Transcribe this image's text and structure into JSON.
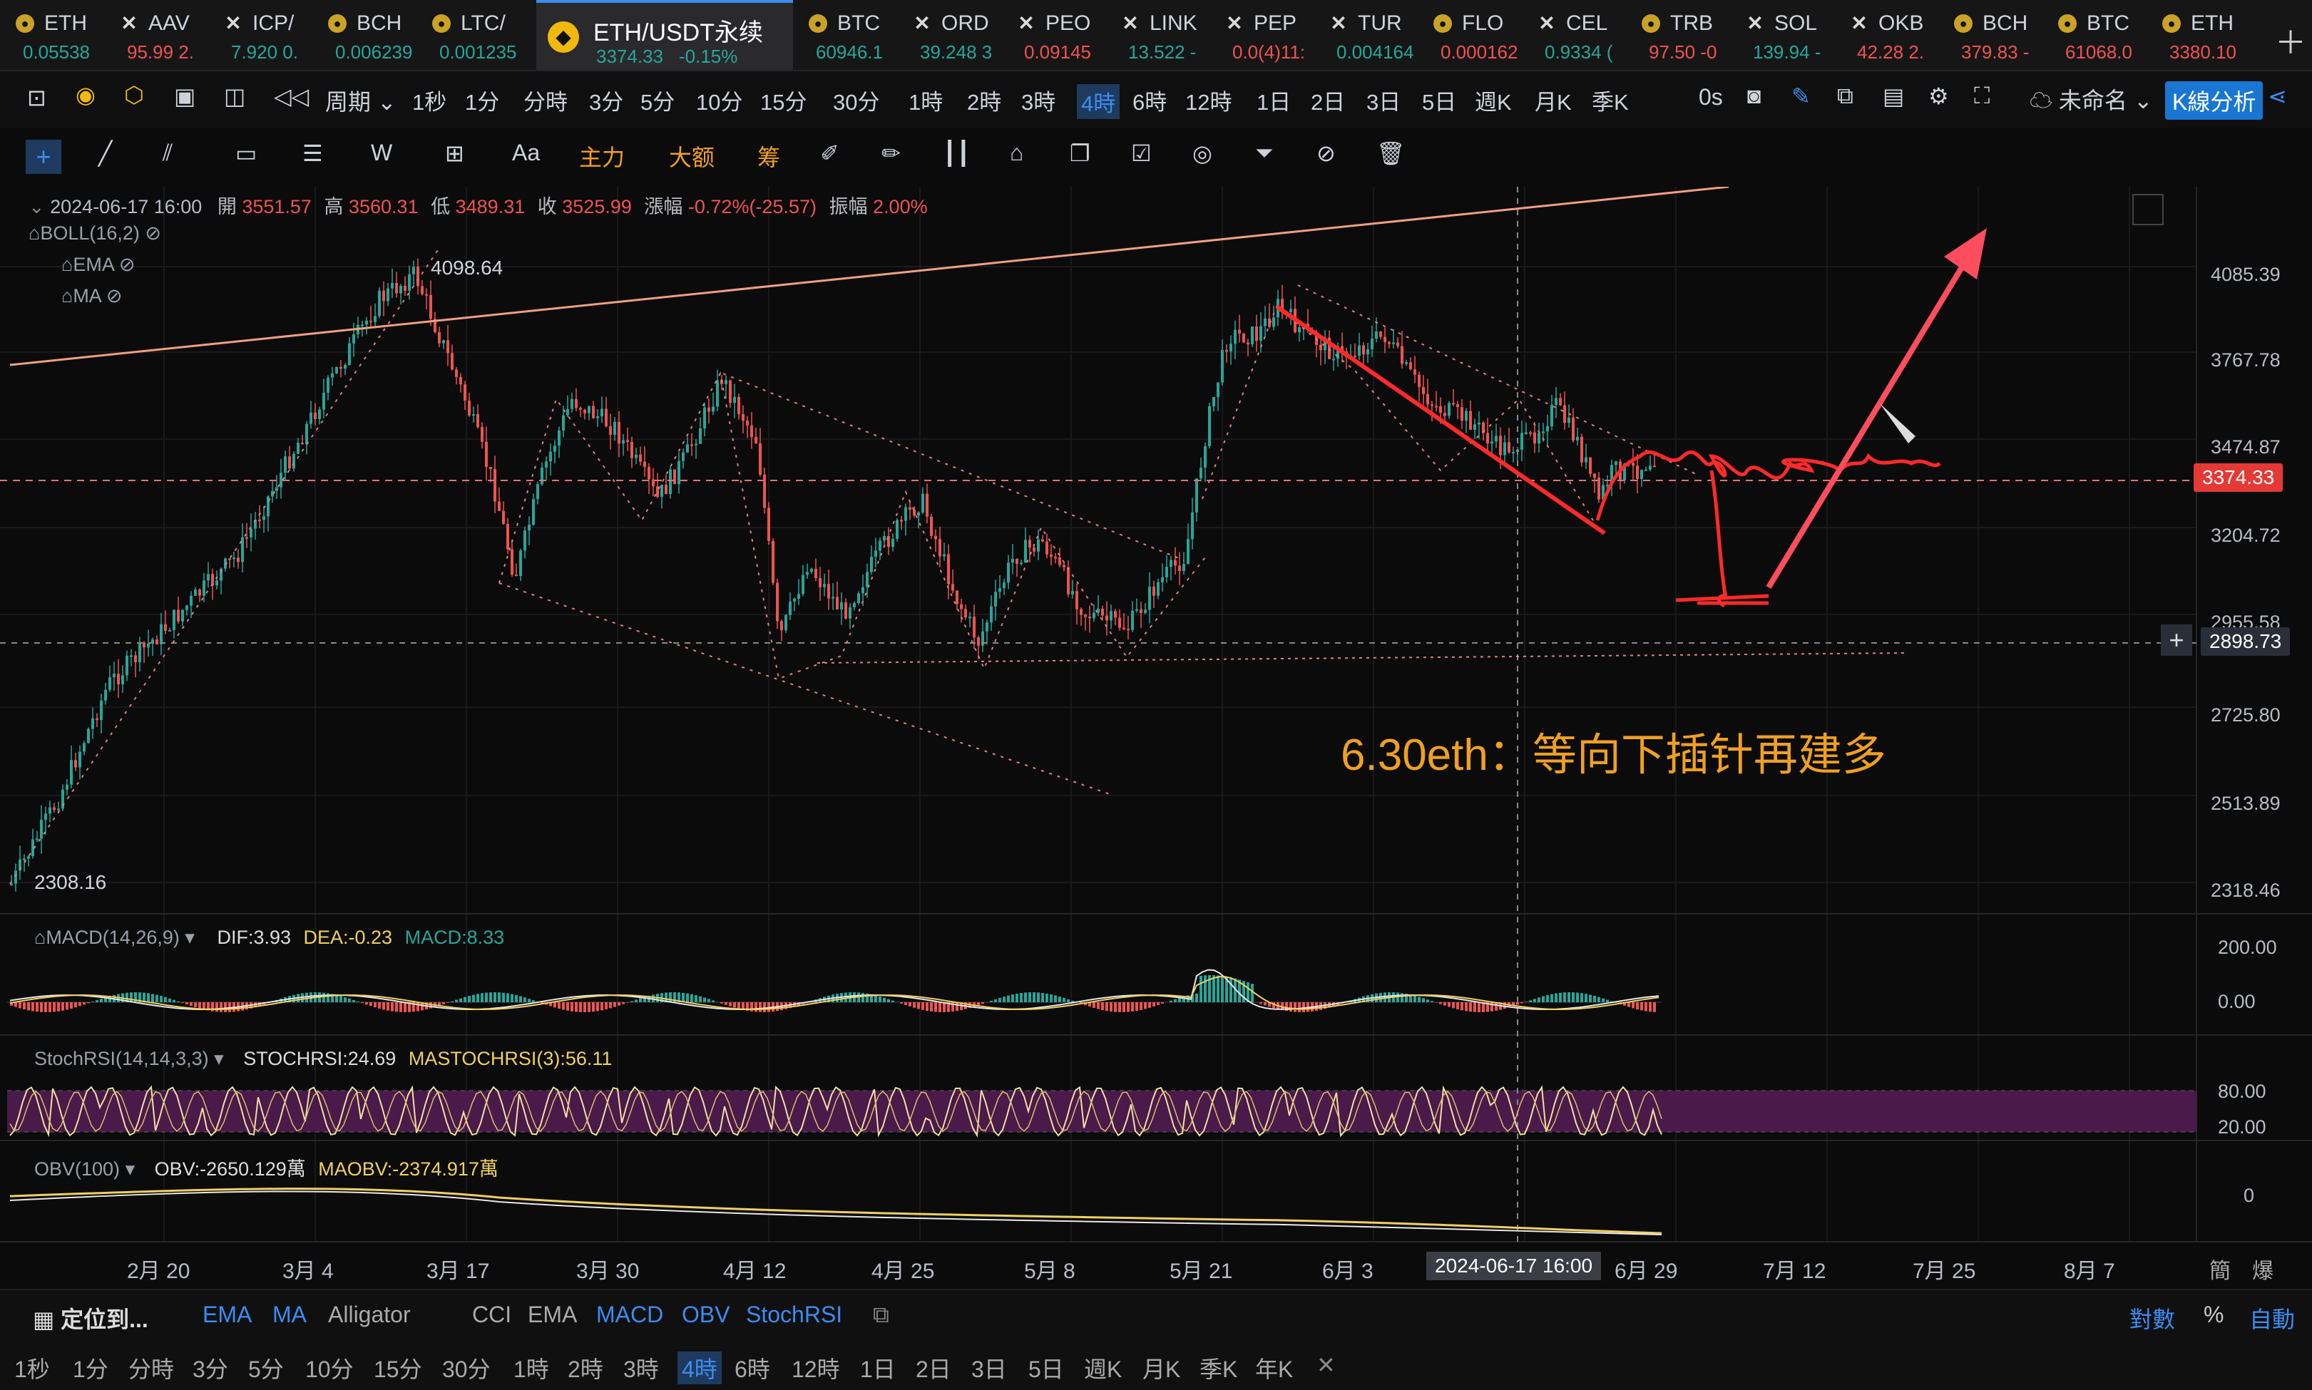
{
  "tickers": [
    {
      "sym": "ETH",
      "val": "0.05538",
      "dir": "up",
      "icon": "coin"
    },
    {
      "sym": "AAV",
      "val": "95.99  2.",
      "dir": "dn",
      "icon": "x"
    },
    {
      "sym": "ICP/",
      "val": "7.920  0.",
      "dir": "up",
      "icon": "x"
    },
    {
      "sym": "BCH",
      "val": "0.006239",
      "dir": "up",
      "icon": "coin"
    },
    {
      "sym": "LTC/",
      "val": "0.001235",
      "dir": "up",
      "icon": "coin"
    },
    {
      "sym": "BTC",
      "val": "60946.1",
      "dir": "up",
      "icon": "coin"
    },
    {
      "sym": "ORD",
      "val": "39.248  3",
      "dir": "up",
      "icon": "x"
    },
    {
      "sym": "PEO",
      "val": "0.09145",
      "dir": "dn",
      "icon": "x"
    },
    {
      "sym": "LINK",
      "val": "13.522  -",
      "dir": "up",
      "icon": "x"
    },
    {
      "sym": "PEP",
      "val": "0.0(4)11:",
      "dir": "dn",
      "icon": "x"
    },
    {
      "sym": "TUR",
      "val": "0.004164",
      "dir": "up",
      "icon": "x"
    },
    {
      "sym": "FLO",
      "val": "0.000162",
      "dir": "dn",
      "icon": "coin"
    },
    {
      "sym": "CEL",
      "val": "0.9334  (",
      "dir": "up",
      "icon": "x"
    },
    {
      "sym": "TRB",
      "val": "97.50  -0",
      "dir": "dn",
      "icon": "coin"
    },
    {
      "sym": "SOL",
      "val": "139.94  -",
      "dir": "up",
      "icon": "x"
    },
    {
      "sym": "OKB",
      "val": "42.28  2.",
      "dir": "dn",
      "icon": "x"
    },
    {
      "sym": "BCH",
      "val": "379.83  -",
      "dir": "dn",
      "icon": "coin"
    },
    {
      "sym": "BTC",
      "val": "61068.0",
      "dir": "dn",
      "icon": "coin"
    },
    {
      "sym": "ETH",
      "val": "3380.10",
      "dir": "dn",
      "icon": "coin"
    }
  ],
  "active_tab": {
    "sym": "ETH/USDT永续",
    "price": "3374.33",
    "chg": "-0.15%"
  },
  "toolbar": {
    "period_label": "周期",
    "intervals": [
      "1秒",
      "1分",
      "分時",
      "3分",
      "5分",
      "10分",
      "15分",
      "30分",
      "1時",
      "2時",
      "3時",
      "4時",
      "6時",
      "12時",
      "1日",
      "2日",
      "3日",
      "5日",
      "週K",
      "月K",
      "季K"
    ],
    "active_interval": "4時",
    "seconds": "0s",
    "layout_name": "未命名",
    "kline_analysis": "K線分析"
  },
  "drawbar": {
    "text_tool": "Aa",
    "zhuli": "主力",
    "dae": "大额",
    "chou": "筹"
  },
  "ohlc": {
    "date": "2024-06-17 16:00",
    "open_label": "開",
    "open": "3551.57",
    "high_label": "高",
    "high": "3560.31",
    "low_label": "低",
    "low": "3489.31",
    "close_label": "收",
    "close": "3525.99",
    "chg_label": "漲幅",
    "chg": "-0.72%(-25.57)",
    "amp_label": "振幅",
    "amp": "2.00%"
  },
  "indicators_main": [
    "BOLL(16,2)",
    "EMA",
    "MA"
  ],
  "annotation": "6.30eth：等向下插针再建多",
  "high_mark": "4098.64",
  "low_mark": "2308.16",
  "price_axis": [
    "4085.39",
    "3767.78",
    "3474.87",
    "3204.72",
    "2955.58",
    "2725.80",
    "2513.89",
    "2318.46"
  ],
  "current_price_tag": "3374.33",
  "crosshair_price": "2898.73",
  "crosshair_time": "2024-06-17 16:00",
  "time_axis": [
    "2月 20",
    "3月 4",
    "3月 17",
    "3月 30",
    "4月 12",
    "4月 25",
    "5月 8",
    "5月 21",
    "6月 3",
    "6月 29",
    "7月 12",
    "7月 25",
    "8月 7"
  ],
  "axis_corner": [
    "簡",
    "爆"
  ],
  "macd": {
    "label": "MACD(14,26,9)",
    "dif": "DIF:3.93",
    "dea": "DEA:-0.23",
    "macd": "MACD:8.33",
    "axis": [
      "200.00",
      "0.00"
    ]
  },
  "stochrsi": {
    "label": "StochRSI(14,14,3,3)",
    "k": "STOCHRSI:24.69",
    "d": "MASTOCHRSI(3):56.11",
    "axis": [
      "80.00",
      "20.00"
    ]
  },
  "obv": {
    "label": "OBV(100)",
    "obv": "OBV:-2650.129萬",
    "ma": "MAOBV:-2374.917萬",
    "axis": [
      "0"
    ]
  },
  "bottom_bar": {
    "locate": "定位到...",
    "inds": [
      "EMA",
      "MA",
      "Alligator",
      "CCI",
      "EMA",
      "MACD",
      "OBV",
      "StochRSI"
    ],
    "log": "對數",
    "pct": "%",
    "auto": "自動"
  },
  "bottom_intervals": [
    "1秒",
    "1分",
    "分時",
    "3分",
    "5分",
    "10分",
    "15分",
    "30分",
    "1時",
    "2時",
    "3時",
    "4時",
    "6時",
    "12時",
    "1日",
    "2日",
    "3日",
    "5日",
    "週K",
    "月K",
    "季K",
    "年K"
  ],
  "colors": {
    "up": "#26a69a",
    "down": "#ef5350",
    "accent": "#3c8cf0",
    "annotation": "#f0a020",
    "price_tag": "#e53935"
  }
}
